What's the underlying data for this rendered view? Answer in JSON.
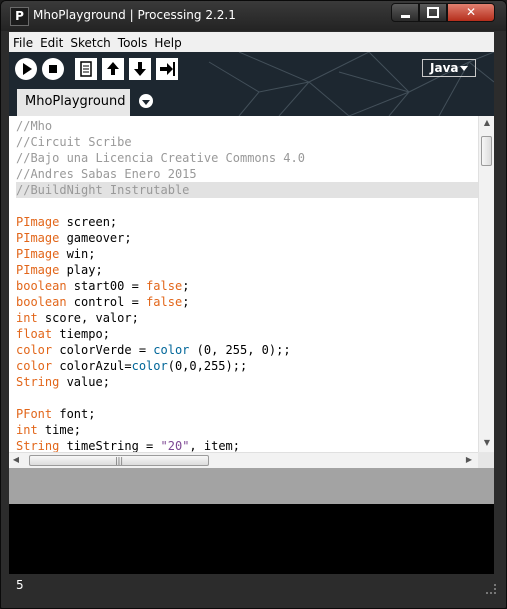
{
  "window": {
    "title": "MhoPlayground | Processing 2.2.1",
    "app_icon": "P",
    "close_label": "✕"
  },
  "menu": [
    "File",
    "Edit",
    "Sketch",
    "Tools",
    "Help"
  ],
  "toolbar": {
    "buttons": [
      "run-icon",
      "stop-icon",
      "new-icon",
      "open-icon",
      "save-icon",
      "export-icon"
    ],
    "mode": "Java"
  },
  "tab": {
    "label": "MhoPlayground"
  },
  "code": [
    [
      [
        "comment",
        "//Mho"
      ]
    ],
    [
      [
        "comment",
        "//Circuit Scribe"
      ]
    ],
    [
      [
        "comment",
        "//Bajo una Licencia Creative Commons 4.0"
      ]
    ],
    [
      [
        "comment",
        "//Andres Sabas Enero 2015"
      ]
    ],
    [
      [
        "comment",
        "//BuildNight Instrutable"
      ]
    ],
    [],
    [
      [
        "type",
        "PImage"
      ],
      [
        "plain",
        " screen;"
      ]
    ],
    [
      [
        "type",
        "PImage"
      ],
      [
        "plain",
        " gameover;"
      ]
    ],
    [
      [
        "type",
        "PImage"
      ],
      [
        "plain",
        " win;"
      ]
    ],
    [
      [
        "type",
        "PImage"
      ],
      [
        "plain",
        " play;"
      ]
    ],
    [
      [
        "type",
        "boolean"
      ],
      [
        "plain",
        " start00 = "
      ],
      [
        "type",
        "false"
      ],
      [
        "plain",
        ";"
      ]
    ],
    [
      [
        "type",
        "boolean"
      ],
      [
        "plain",
        " control = "
      ],
      [
        "type",
        "false"
      ],
      [
        "plain",
        ";"
      ]
    ],
    [
      [
        "type",
        "int"
      ],
      [
        "plain",
        " score, valor;"
      ]
    ],
    [
      [
        "type",
        "float"
      ],
      [
        "plain",
        " tiempo;"
      ]
    ],
    [
      [
        "type",
        "color"
      ],
      [
        "plain",
        " colorVerde = "
      ],
      [
        "func",
        "color"
      ],
      [
        "plain",
        " (0, 255, 0);;"
      ]
    ],
    [
      [
        "type",
        "color"
      ],
      [
        "plain",
        " colorAzul="
      ],
      [
        "func",
        "color"
      ],
      [
        "plain",
        "(0,0,255);;"
      ]
    ],
    [
      [
        "type",
        "String"
      ],
      [
        "plain",
        " value;"
      ]
    ],
    [],
    [
      [
        "type",
        "PFont"
      ],
      [
        "plain",
        " font;"
      ]
    ],
    [
      [
        "type",
        "int"
      ],
      [
        "plain",
        " time;"
      ]
    ],
    [
      [
        "type",
        "String"
      ],
      [
        "plain",
        " timeString = "
      ],
      [
        "str",
        "\"20\""
      ],
      [
        "plain",
        ", item;"
      ]
    ]
  ],
  "current_line": 5,
  "status": {
    "line_number": "5"
  },
  "colors": {
    "comment": "#999999",
    "type": "#e2661a",
    "func": "#006699",
    "string": "#7d4793"
  }
}
